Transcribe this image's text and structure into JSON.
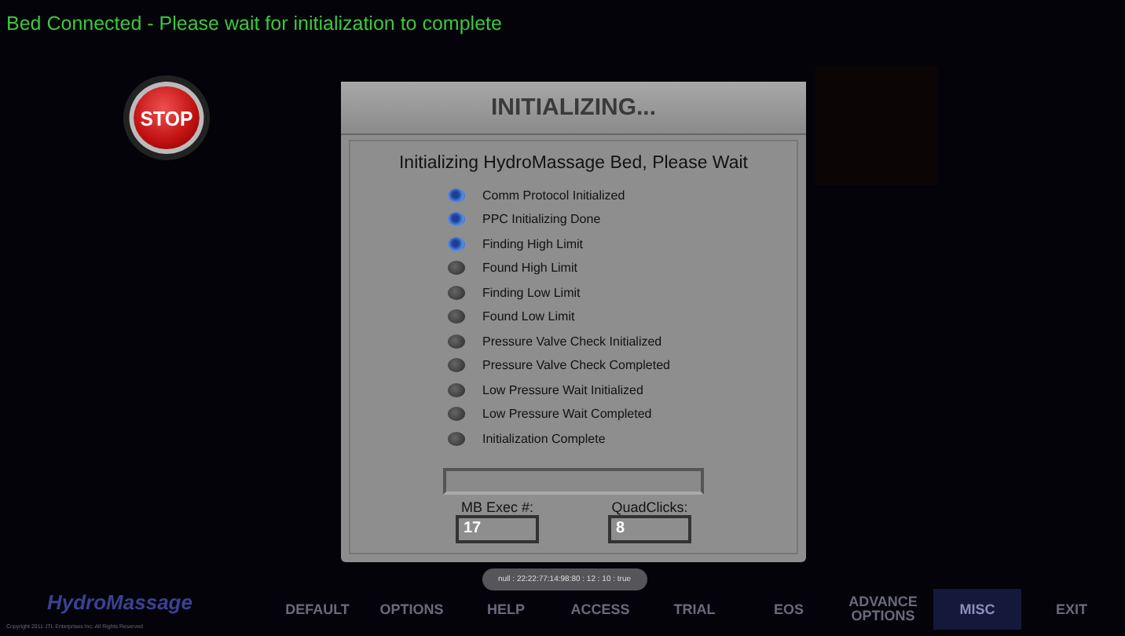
{
  "status_message": "Bed Connected - Please wait for initialization to complete",
  "stop_button": {
    "label": "STOP"
  },
  "dialog": {
    "title": "INITIALIZING...",
    "heading": "Initializing HydroMassage Bed, Please Wait",
    "steps": [
      {
        "label": "Comm Protocol Initialized",
        "done": true
      },
      {
        "label": "PPC Initializing Done",
        "done": true
      },
      {
        "label": "Finding High Limit",
        "done": true
      },
      {
        "label": "Found High Limit",
        "done": false
      },
      {
        "label": "Finding Low Limit",
        "done": false
      },
      {
        "label": "Found Low Limit",
        "done": false
      },
      {
        "label": "Pressure Valve Check Initialized",
        "done": false
      },
      {
        "label": "Pressure Valve Check Completed",
        "done": false
      },
      {
        "label": "Low Pressure Wait Initialized",
        "done": false
      },
      {
        "label": "Low Pressure Wait Completed",
        "done": false
      },
      {
        "label": "Initialization Complete",
        "done": false
      }
    ],
    "counters": [
      {
        "label": "MB Exec #:",
        "value": "17"
      },
      {
        "label": "QuadClicks:",
        "value": "8"
      }
    ]
  },
  "toast": "null : 22:22:77:14:98:80 : 12 : 10 : true",
  "logo": "HydroMassage",
  "copyright": "Copyright 2011 JTL Enterprises Inc. All Rights Reserved",
  "nav": [
    {
      "label": "DEFAULT",
      "selected": false
    },
    {
      "label": "OPTIONS",
      "selected": false
    },
    {
      "label": "HELP",
      "selected": false
    },
    {
      "label": "ACCESS",
      "selected": false
    },
    {
      "label": "TRIAL",
      "selected": false
    },
    {
      "label": "EOS",
      "selected": false
    },
    {
      "label": "ADVANCE OPTIONS",
      "selected": false
    },
    {
      "label": "MISC",
      "selected": true
    },
    {
      "label": "EXIT",
      "selected": false
    }
  ]
}
